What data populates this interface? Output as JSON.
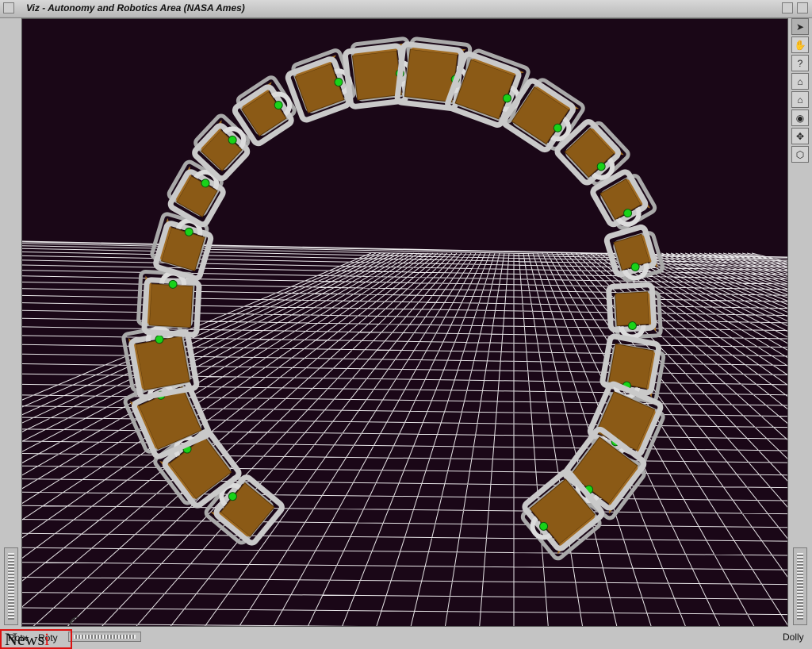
{
  "window": {
    "title": "Viz - Autonomy and Robotics Area (NASA Ames)"
  },
  "toolbar": {
    "tools": [
      {
        "name": "pointer-icon",
        "glyph": "➤"
      },
      {
        "name": "hand-icon",
        "glyph": "✋"
      },
      {
        "name": "help-icon",
        "glyph": "?"
      },
      {
        "name": "home-icon",
        "glyph": "⌂"
      },
      {
        "name": "set-home-icon",
        "glyph": "⌂"
      },
      {
        "name": "view-all-icon",
        "glyph": "◉"
      },
      {
        "name": "seek-icon",
        "glyph": "✥"
      },
      {
        "name": "perspective-icon",
        "glyph": "⬡"
      }
    ]
  },
  "bottom": {
    "rot_x_label": "Rotx",
    "roty_label": "Roty",
    "dolly_label": "Dolly"
  },
  "watermark": {
    "main": "News",
    "suffix": "i"
  },
  "colors": {
    "background": "#1a0717",
    "grid": "#ffffff",
    "module_frame": "#c9c9c9",
    "module_body": "#8b5a16",
    "joint": "#19d319"
  }
}
